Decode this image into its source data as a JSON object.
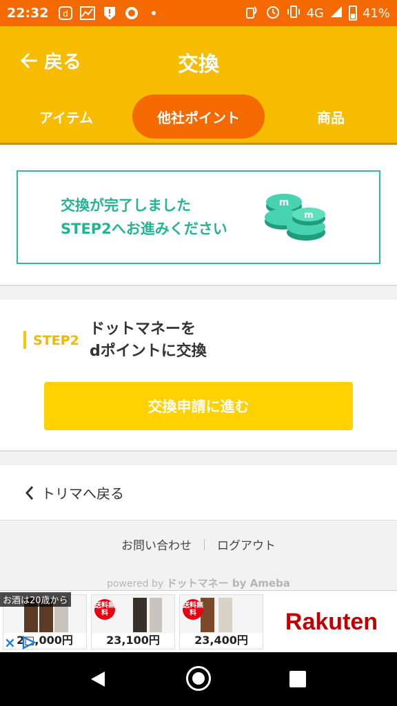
{
  "status_bar": {
    "time": "22:32",
    "network": "4G",
    "battery": "41%"
  },
  "header": {
    "back_label": "戻る",
    "title": "交換"
  },
  "tabs": [
    {
      "label": "アイテム",
      "active": false
    },
    {
      "label": "他社ポイント",
      "active": true
    },
    {
      "label": "商品",
      "active": false
    }
  ],
  "complete": {
    "line1": "交換が完了しました",
    "line2": "STEP2へお進みください"
  },
  "step2": {
    "label": "STEP2",
    "title_line1": "ドットマネーを",
    "title_line2": "dポイントに交換",
    "button": "交換申請に進む"
  },
  "trima_back": "トリマへ戻る",
  "footer": {
    "contact": "お問い合わせ",
    "logout": "ログアウト",
    "powered_prefix": "powered by",
    "powered_brand": "ドットマネー by Ameba"
  },
  "ad": {
    "tag": "お酒は20歳から",
    "ship_label": "送料無料",
    "items": [
      {
        "price": "2□,000円"
      },
      {
        "price": "23,100円"
      },
      {
        "price": "23,400円"
      }
    ],
    "brand": "Rakuten"
  },
  "colors": {
    "status_bar": "#f46a00",
    "header": "#f7bb00",
    "active_tab": "#f46a00",
    "accent_green": "#22b394",
    "button": "#ffd100"
  }
}
